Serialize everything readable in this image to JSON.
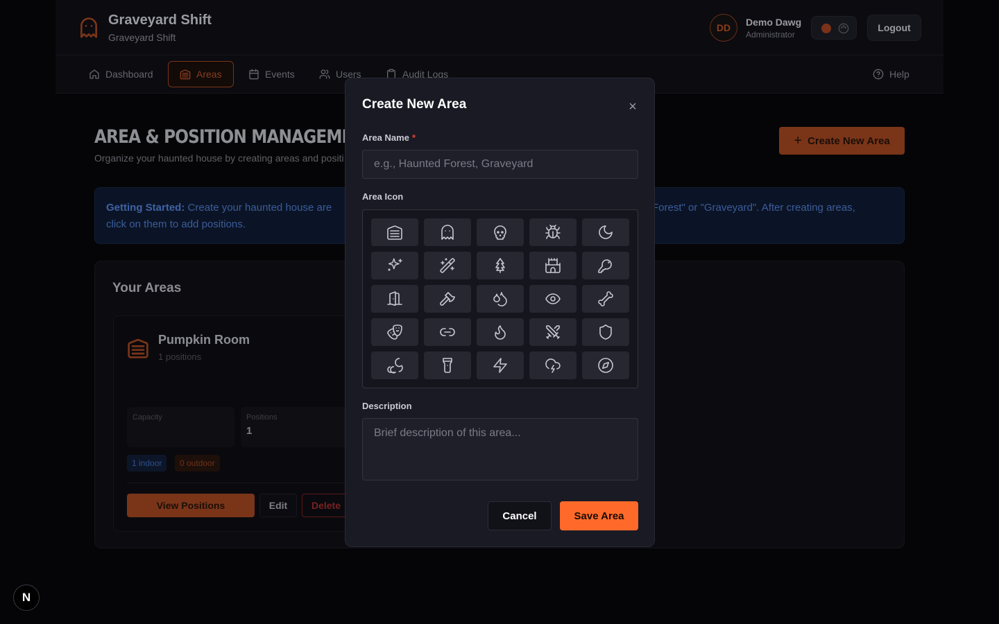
{
  "header": {
    "brand_title": "Graveyard Shift",
    "brand_subtitle": "Graveyard Shift",
    "user_initials": "DD",
    "user_name": "Demo Dawg",
    "user_role": "Administrator",
    "logout_label": "Logout"
  },
  "nav": {
    "items": [
      {
        "label": "Dashboard",
        "icon": "home-icon"
      },
      {
        "label": "Areas",
        "icon": "warehouse-icon"
      },
      {
        "label": "Events",
        "icon": "calendar-icon"
      },
      {
        "label": "Users",
        "icon": "users-icon"
      },
      {
        "label": "Audit Logs",
        "icon": "clipboard-icon"
      }
    ],
    "active": "Areas",
    "help_label": "Help"
  },
  "page": {
    "title": "AREA & POSITION MANAGEMENT",
    "subtitle": "Organize your haunted house by creating areas and positi",
    "create_button": "Create New Area",
    "info_bold": "Getting Started:",
    "info_text_left": "Create your haunted house are",
    "info_text_line2": "click on them to add positions.",
    "info_text_right": "Forest\" or \"Graveyard\". After creating areas,",
    "areas_heading": "Your Areas"
  },
  "area_card": {
    "name": "Pumpkin Room",
    "positions_text": "1 positions",
    "capacity_label": "Capacity",
    "positions_label": "Positions",
    "positions_value": "1",
    "indoor_tag": "1 indoor",
    "outdoor_tag": "0 outdoor",
    "view_button": "View Positions",
    "edit_button": "Edit",
    "delete_button": "Delete"
  },
  "modal": {
    "title": "Create New Area",
    "close_label": "×",
    "name_label": "Area Name",
    "required_mark": "*",
    "name_placeholder": "e.g., Haunted Forest, Graveyard",
    "icon_label": "Area Icon",
    "icons": [
      "warehouse-icon",
      "ghost-icon",
      "skull-icon",
      "bug-icon",
      "moon-icon",
      "sparkles-icon",
      "wand-icon",
      "tree-icon",
      "castle-icon",
      "key-icon",
      "door-icon",
      "axe-icon",
      "droplets-icon",
      "eye-icon",
      "bone-icon",
      "drama-mask-icon",
      "chain-link-icon",
      "flame-icon",
      "swords-icon",
      "shield-icon",
      "cloud-moon-icon",
      "flashlight-icon",
      "lightning-icon",
      "cloud-lightning-icon",
      "compass-icon"
    ],
    "description_label": "Description",
    "description_placeholder": "Brief description of this area...",
    "cancel_button": "Cancel",
    "save_button": "Save Area"
  },
  "framework_badge": "N",
  "colors": {
    "accent": "#ff6a2a",
    "modal_bg": "#1a1a24",
    "page_bg": "#050507"
  }
}
